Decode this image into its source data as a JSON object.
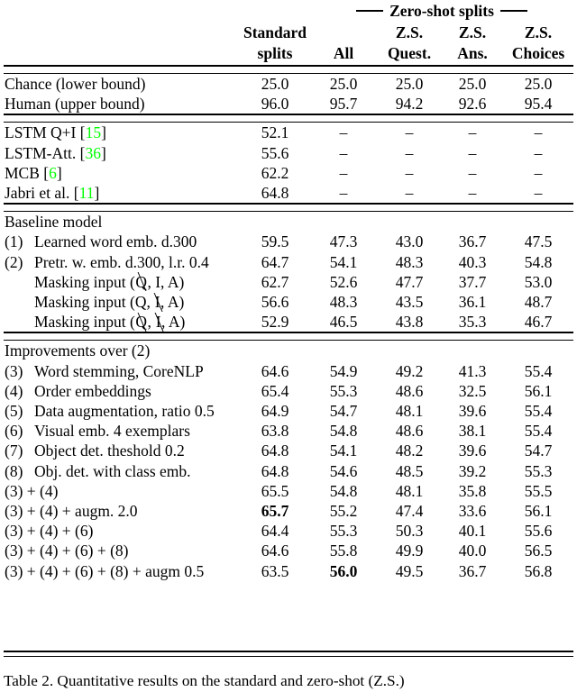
{
  "table": {
    "group_header": {
      "left_dash": "——",
      "label": "Zero-shot splits",
      "right_dash": "——"
    },
    "columns": [
      {
        "id": "label",
        "line1": "",
        "line2": ""
      },
      {
        "id": "standard",
        "line1": "Standard",
        "line2": "splits"
      },
      {
        "id": "all",
        "line1": "",
        "line2": "All"
      },
      {
        "id": "zs_quest",
        "line1": "Z.S.",
        "line2": "Quest."
      },
      {
        "id": "zs_ans",
        "line1": "Z.S.",
        "line2": "Ans."
      },
      {
        "id": "zs_choices",
        "line1": "Z.S.",
        "line2": "Choices"
      }
    ],
    "sections": [
      {
        "id": "bounds",
        "rows": [
          {
            "index": "",
            "label": "Chance (lower bound)",
            "values": [
              "25.0",
              "25.0",
              "25.0",
              "25.0",
              "25.0"
            ],
            "bold": []
          },
          {
            "index": "",
            "label": "Human (upper bound)",
            "values": [
              "96.0",
              "95.7",
              "94.2",
              "92.6",
              "95.4"
            ],
            "bold": []
          }
        ]
      },
      {
        "id": "prior-work",
        "rows": [
          {
            "index": "",
            "label": "LSTM Q+I",
            "cite": "15",
            "values": [
              "52.1",
              "–",
              "–",
              "–",
              "–"
            ],
            "bold": []
          },
          {
            "index": "",
            "label": "LSTM-Att.",
            "cite": "36",
            "values": [
              "55.6",
              "–",
              "–",
              "–",
              "–"
            ],
            "bold": []
          },
          {
            "index": "",
            "label": "MCB",
            "cite": "6",
            "values": [
              "62.2",
              "–",
              "–",
              "–",
              "–"
            ],
            "bold": []
          },
          {
            "index": "",
            "label": "Jabri et al.",
            "cite": "11",
            "values": [
              "64.8",
              "–",
              "–",
              "–",
              "–"
            ],
            "bold": []
          }
        ]
      },
      {
        "id": "baseline",
        "heading": "Baseline model",
        "rows": [
          {
            "index": "(1)",
            "label": "Learned word emb. d.300",
            "values": [
              "59.5",
              "47.3",
              "43.0",
              "36.7",
              "47.5"
            ],
            "bold": []
          },
          {
            "index": "(2)",
            "label": "Pretr. w. emb. d.300, l.r. 0.4",
            "values": [
              "64.7",
              "54.1",
              "48.3",
              "40.3",
              "54.8"
            ],
            "bold": []
          },
          {
            "index": "",
            "label": "Masking input (Q̸, I, A)",
            "mask": [
              "Q",
              null
            ],
            "values": [
              "62.7",
              "52.6",
              "47.7",
              "37.7",
              "53.0"
            ],
            "bold": []
          },
          {
            "index": "",
            "label": "Masking input (Q, I̸, A)",
            "mask": [
              null,
              "I"
            ],
            "values": [
              "56.6",
              "48.3",
              "43.5",
              "36.1",
              "48.7"
            ],
            "bold": []
          },
          {
            "index": "",
            "label": "Masking input (Q̸, I̸, A)",
            "mask": [
              "Q",
              "I"
            ],
            "values": [
              "52.9",
              "46.5",
              "43.8",
              "35.3",
              "46.7"
            ],
            "bold": []
          }
        ]
      },
      {
        "id": "improvements",
        "heading": "Improvements over (2)",
        "rows": [
          {
            "index": "(3)",
            "label": "Word stemming, CoreNLP",
            "values": [
              "64.6",
              "54.9",
              "49.2",
              "41.3",
              "55.4"
            ],
            "bold": []
          },
          {
            "index": "(4)",
            "label": "Order embeddings",
            "values": [
              "65.4",
              "55.3",
              "48.6",
              "32.5",
              "56.1"
            ],
            "bold": []
          },
          {
            "index": "(5)",
            "label": "Data augmentation, ratio 0.5",
            "values": [
              "64.9",
              "54.7",
              "48.1",
              "39.6",
              "55.4"
            ],
            "bold": []
          },
          {
            "index": "(6)",
            "label": "Visual emb. 4 exemplars",
            "values": [
              "63.8",
              "54.8",
              "48.6",
              "38.1",
              "55.4"
            ],
            "bold": []
          },
          {
            "index": "(7)",
            "label": "Object det. theshold 0.2",
            "values": [
              "64.8",
              "54.1",
              "48.2",
              "39.6",
              "54.7"
            ],
            "bold": []
          },
          {
            "index": "(8)",
            "label": "Obj. det. with class emb.",
            "values": [
              "64.8",
              "54.6",
              "48.5",
              "39.2",
              "55.3"
            ],
            "bold": []
          },
          {
            "index": "",
            "label": "(3) + (4)",
            "noindent": true,
            "values": [
              "65.5",
              "54.8",
              "48.1",
              "35.8",
              "55.5"
            ],
            "bold": []
          },
          {
            "index": "",
            "label": "(3) + (4) + augm. 2.0",
            "noindent": true,
            "values": [
              "65.7",
              "55.2",
              "47.4",
              "33.6",
              "56.1"
            ],
            "bold": [
              0
            ]
          },
          {
            "index": "",
            "label": "(3) + (4) + (6)",
            "noindent": true,
            "values": [
              "64.4",
              "55.3",
              "50.3",
              "40.1",
              "55.6"
            ],
            "bold": []
          },
          {
            "index": "",
            "label": "(3) + (4) + (6) + (8)",
            "noindent": true,
            "values": [
              "64.6",
              "55.8",
              "49.9",
              "40.0",
              "56.5"
            ],
            "bold": []
          },
          {
            "index": "",
            "label": "(3) + (4) + (6) + (8) + augm 0.5",
            "noindent": true,
            "values": [
              "63.5",
              "56.0",
              "49.5",
              "36.7",
              "56.8"
            ],
            "bold": [
              1
            ]
          }
        ]
      }
    ]
  },
  "caption": {
    "text": "Table 2. Quantitative results on the standard and zero-shot (Z.S.)"
  }
}
